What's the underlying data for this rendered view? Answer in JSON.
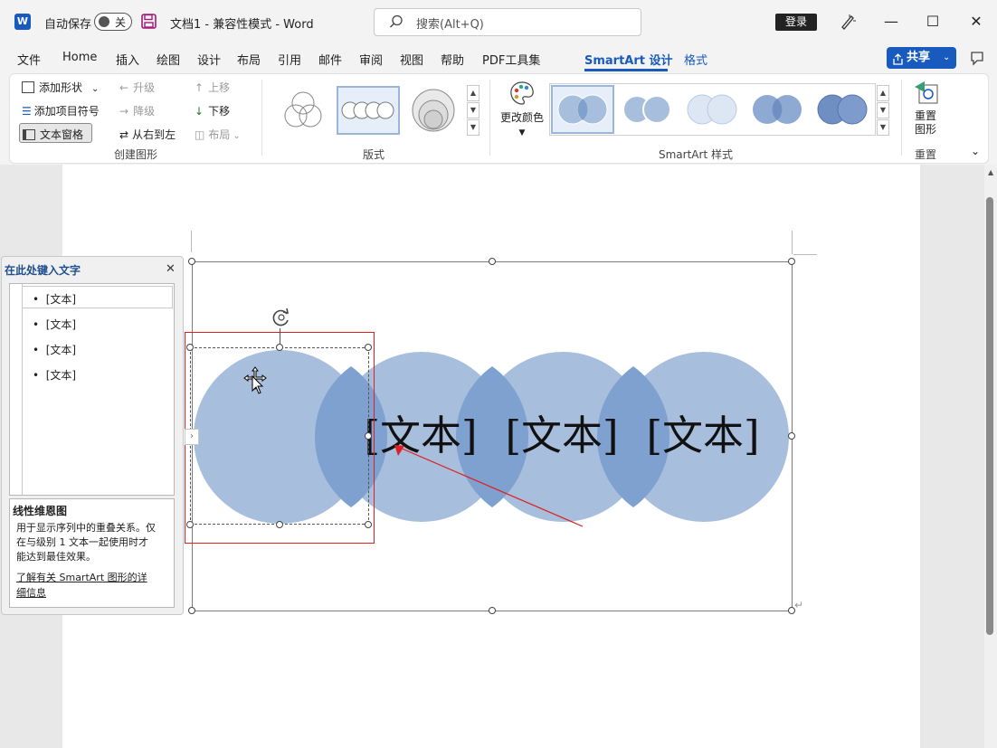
{
  "titlebar": {
    "autosave_label": "自动保存",
    "autosave_state": "关",
    "doc_title": "文档1  -  兼容性模式  -  Word",
    "search_placeholder": "搜索(Alt+Q)",
    "login_label": "登录"
  },
  "menu": {
    "items": [
      "文件",
      "Home",
      "插入",
      "绘图",
      "设计",
      "布局",
      "引用",
      "邮件",
      "审阅",
      "视图",
      "帮助",
      "PDF工具集",
      "SmartArt 设计",
      "格式"
    ],
    "active": "SmartArt 设计",
    "share_label": "共享"
  },
  "ribbon": {
    "create": {
      "add_shape": "添加形状",
      "add_bullet": "添加项目符号",
      "text_pane": "文本窗格",
      "promote": "升级",
      "demote": "降级",
      "rtl": "从右到左",
      "move_up": "上移",
      "move_down": "下移",
      "layout": "布局",
      "group_label": "创建图形"
    },
    "layouts": {
      "group_label": "版式"
    },
    "styles": {
      "change_colors": "更改颜色",
      "group_label": "SmartArt 样式"
    },
    "reset": {
      "reset_graphic_line1": "重置",
      "reset_graphic_line2": "图形",
      "group_label": "重置"
    }
  },
  "text_pane": {
    "title": "在此处键入文字",
    "items": [
      "[文本]",
      "[文本]",
      "[文本]",
      "[文本]"
    ],
    "desc_title": "线性维恩图",
    "desc_text_1": "用于显示序列中的重叠关系。仅",
    "desc_text_2": "在与级别 1 文本一起使用时才",
    "desc_text_3": "能达到最佳效果。",
    "learn_more_1": "了解有关 SmartArt 图形的详",
    "learn_more_2": "细信息"
  },
  "smartart": {
    "circle_labels": [
      "[文本]",
      "[文本]",
      "[文本]"
    ],
    "circle_color": "#a7bedd",
    "overlap_color": "#7fa1cf"
  },
  "colors": {
    "accent": "#185abd",
    "selection_red": "#e02020"
  }
}
